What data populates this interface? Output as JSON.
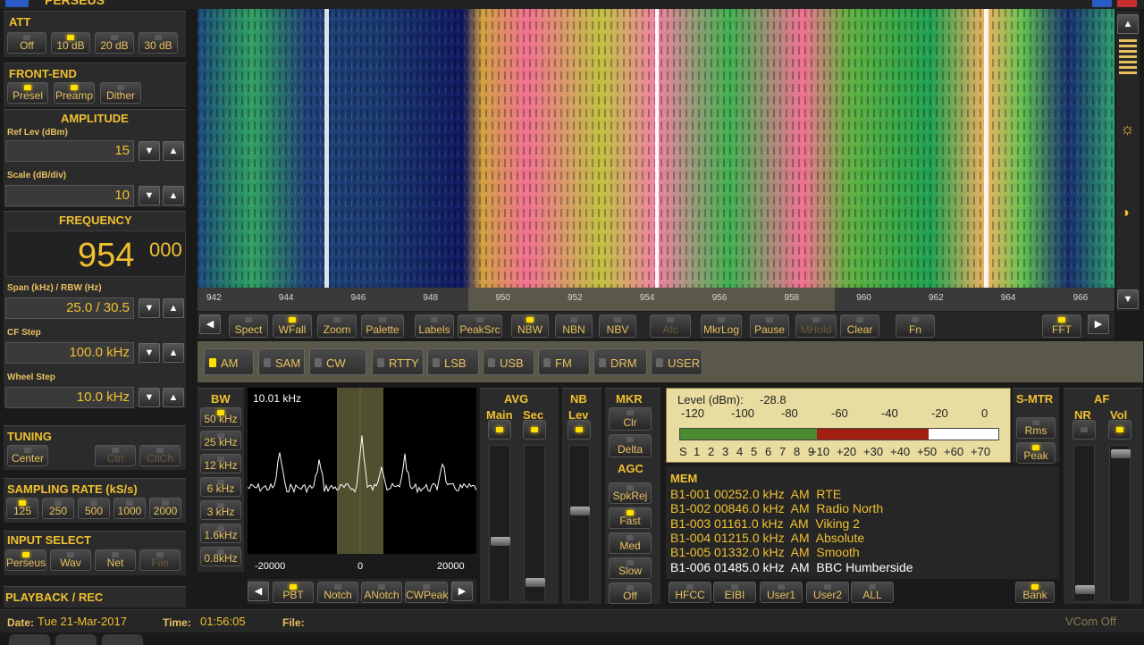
{
  "app": {
    "title": "PERSEUS"
  },
  "att": {
    "title": "ATT",
    "buttons": [
      {
        "label": "Off",
        "on": false
      },
      {
        "label": "10 dB",
        "on": true
      },
      {
        "label": "20 dB",
        "on": false
      },
      {
        "label": "30 dB",
        "on": false
      }
    ]
  },
  "frontend": {
    "title": "FRONT-END",
    "buttons": [
      {
        "label": "Presel",
        "on": true
      },
      {
        "label": "Preamp",
        "on": true
      },
      {
        "label": "Dither",
        "on": false
      }
    ]
  },
  "amplitude": {
    "title": "AMPLITUDE",
    "ref_label": "Ref Lev (dBm)",
    "ref_value": "15",
    "scale_label": "Scale (dB/div)",
    "scale_value": "10"
  },
  "frequency": {
    "title": "FREQUENCY",
    "main": "954",
    "sub": "000",
    "span_label": "Span (kHz) / RBW (Hz)",
    "span_value": "25.0 / 30.5",
    "cfstep_label": "CF Step",
    "cfstep_value": "100.0 kHz",
    "wheel_label": "Wheel Step",
    "wheel_value": "10.0 kHz"
  },
  "tuning": {
    "title": "TUNING",
    "buttons": [
      {
        "label": "Center",
        "on": false
      },
      {
        "label": "Ctrl",
        "on": false
      },
      {
        "label": "CtlCh",
        "on": false
      }
    ]
  },
  "sampling": {
    "title": "SAMPLING RATE (kS/s)",
    "buttons": [
      {
        "label": "125",
        "on": true
      },
      {
        "label": "250",
        "on": false
      },
      {
        "label": "500",
        "on": false
      },
      {
        "label": "1000",
        "on": false
      },
      {
        "label": "2000",
        "on": false
      }
    ]
  },
  "input": {
    "title": "INPUT SELECT",
    "buttons": [
      {
        "label": "Perseus",
        "on": true
      },
      {
        "label": "Wav",
        "on": false
      },
      {
        "label": "Net",
        "on": false
      },
      {
        "label": "File",
        "on": false
      }
    ]
  },
  "playback": {
    "title": "PLAYBACK / REC"
  },
  "status": {
    "date_label": "Date:",
    "date": "Tue 21-Mar-2017",
    "time_label": "Time:",
    "time": "01:56:05",
    "file_label": "File:",
    "vcom": "VCom Off"
  },
  "waterfall": {
    "ticks": [
      "942",
      "944",
      "946",
      "948",
      "950",
      "952",
      "954",
      "956",
      "958",
      "960",
      "962",
      "964",
      "966"
    ]
  },
  "toolbar": {
    "buttons": [
      {
        "label": "Spect",
        "on": false
      },
      {
        "label": "WFall",
        "on": true
      },
      {
        "label": "Zoom",
        "on": false
      },
      {
        "label": "Palette",
        "on": false
      },
      {
        "label": "Labels",
        "on": false
      },
      {
        "label": "PeakSrc",
        "on": false
      },
      {
        "label": "NBW",
        "on": true
      },
      {
        "label": "NBN",
        "on": false
      },
      {
        "label": "NBV",
        "on": false
      },
      {
        "label": "Afc",
        "on": false
      },
      {
        "label": "MkrLog",
        "on": false
      },
      {
        "label": "Pause",
        "on": false
      },
      {
        "label": "MHold",
        "on": false
      },
      {
        "label": "Clear",
        "on": false
      },
      {
        "label": "Fn",
        "on": false
      },
      {
        "label": "FFT",
        "on": true
      }
    ]
  },
  "modes": [
    {
      "label": "AM",
      "on": true
    },
    {
      "label": "SAM",
      "on": false
    },
    {
      "label": "CW",
      "on": false
    },
    {
      "label": "RTTY",
      "on": false
    },
    {
      "label": "LSB",
      "on": false
    },
    {
      "label": "USB",
      "on": false
    },
    {
      "label": "FM",
      "on": false
    },
    {
      "label": "DRM",
      "on": false
    },
    {
      "label": "USER",
      "on": false
    }
  ],
  "bw": {
    "title": "BW",
    "buttons": [
      {
        "label": "50 kHz",
        "on": true
      },
      {
        "label": "25 kHz",
        "on": false
      },
      {
        "label": "12 kHz",
        "on": false
      },
      {
        "label": "6 kHz",
        "on": false
      },
      {
        "label": "3 kHz",
        "on": false
      },
      {
        "label": "1.6kHz",
        "on": false
      },
      {
        "label": "0.8kHz",
        "on": false
      }
    ]
  },
  "filter": {
    "readout": "10.01 kHz",
    "ticks": [
      "-20000",
      "0",
      "20000"
    ],
    "buttons": [
      {
        "label": "PBT",
        "on": true
      },
      {
        "label": "Notch",
        "on": false
      },
      {
        "label": "ANotch",
        "on": false
      },
      {
        "label": "CWPeak",
        "on": false
      }
    ]
  },
  "avg": {
    "title": "AVG",
    "main": "Main",
    "sec": "Sec"
  },
  "nb": {
    "title": "NB",
    "lev": "Lev"
  },
  "mkr": {
    "title": "MKR",
    "buttons": [
      "Clr",
      "Delta"
    ]
  },
  "agc": {
    "title": "AGC",
    "buttons": [
      {
        "label": "SpkRej",
        "on": false
      },
      {
        "label": "Fast",
        "on": true
      },
      {
        "label": "Med",
        "on": false
      },
      {
        "label": "Slow",
        "on": false
      },
      {
        "label": "Off",
        "on": false
      }
    ]
  },
  "smeter": {
    "level_label": "Level (dBm):",
    "level_value": "-28.8",
    "scale_top": [
      "-120",
      "-100",
      "-80",
      "-60",
      "-40",
      "-20",
      "0"
    ],
    "scale_bottom": [
      "S",
      "1",
      "2",
      "3",
      "4",
      "5",
      "6",
      "7",
      "8",
      "9",
      "+10",
      "+20",
      "+30",
      "+40",
      "+50",
      "+60",
      "+70"
    ],
    "level_fraction": 0.78
  },
  "smtr": {
    "title": "S-MTR",
    "buttons": [
      {
        "label": "Rms",
        "on": false
      },
      {
        "label": "Peak",
        "on": true
      }
    ]
  },
  "af": {
    "title": "AF",
    "nr": "NR",
    "vol": "Vol"
  },
  "mem": {
    "title": "MEM",
    "rows": [
      "B1-001 00252.0 kHz  AM  RTE",
      "B1-002 00846.0 kHz  AM  Radio North",
      "B1-003 01161.0 kHz  AM  Viking 2",
      "B1-004 01215.0 kHz  AM  Absolute",
      "B1-005 01332.0 kHz  AM  Smooth",
      "B1-006 01485.0 kHz  AM  BBC Humberside"
    ],
    "buttons": [
      "HFCC",
      "EIBI",
      "User1",
      "User2",
      "ALL",
      "Bank"
    ]
  },
  "colors": {
    "accent": "#f0c030",
    "led_on": "#ffe000",
    "panel": "#2b2b2b"
  }
}
